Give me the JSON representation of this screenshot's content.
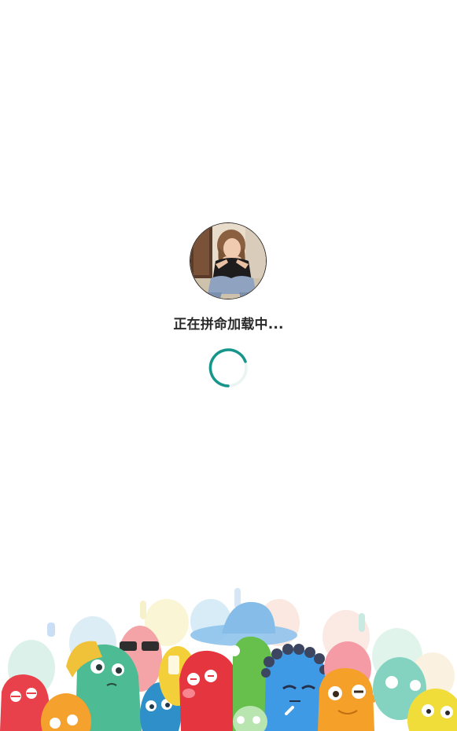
{
  "loading": {
    "avatar_description_icon": "user-avatar-photo",
    "message": "正在拼命加载中...",
    "spinner_icon": "loading-spinner-icon",
    "spinner_color": "#16958a"
  },
  "footer": {
    "illustration_icon": "colorful-monster-crowd-illustration",
    "colors": [
      "#e8414b",
      "#f4a12e",
      "#4fba98",
      "#3a90c8",
      "#f0d84a",
      "#5fa8e8"
    ]
  }
}
